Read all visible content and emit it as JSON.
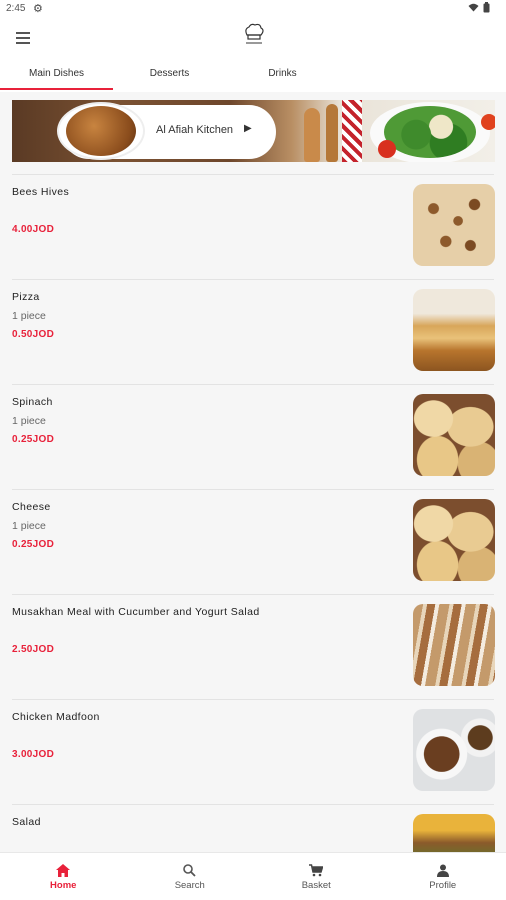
{
  "status_bar": {
    "time": "2:45"
  },
  "tabs": [
    {
      "label": "Main Dishes",
      "active": true
    },
    {
      "label": "Desserts",
      "active": false
    },
    {
      "label": "Drinks",
      "active": false
    }
  ],
  "banner": {
    "title": "Al Afiah Kitchen"
  },
  "menu_items": [
    {
      "name": "Bees Hives",
      "description": "",
      "price": "4.00JOD",
      "image": "bees-hives-image"
    },
    {
      "name": "Pizza",
      "description": "1 piece",
      "price": "0.50JOD",
      "image": "pizza-image"
    },
    {
      "name": "Spinach",
      "description": "1 piece",
      "price": "0.25JOD",
      "image": "spinach-image"
    },
    {
      "name": "Cheese",
      "description": "1 piece",
      "price": "0.25JOD",
      "image": "cheese-image"
    },
    {
      "name": "Musakhan Meal with Cucumber and Yogurt Salad",
      "description": "",
      "price": "2.50JOD",
      "image": "musakhan-image"
    },
    {
      "name": "Chicken Madfoon",
      "description": "",
      "price": "3.00JOD",
      "image": "chicken-madfoon-image"
    },
    {
      "name": "Salad",
      "description": "",
      "price": "",
      "image": "salad-image"
    }
  ],
  "bottom_nav": [
    {
      "label": "Home",
      "icon": "home-icon",
      "active": true
    },
    {
      "label": "Search",
      "icon": "search-icon",
      "active": false
    },
    {
      "label": "Basket",
      "icon": "cart-icon",
      "active": false
    },
    {
      "label": "Profile",
      "icon": "profile-icon",
      "active": false
    }
  ],
  "colors": {
    "accent": "#e8213a",
    "background": "#f6f6f6"
  }
}
